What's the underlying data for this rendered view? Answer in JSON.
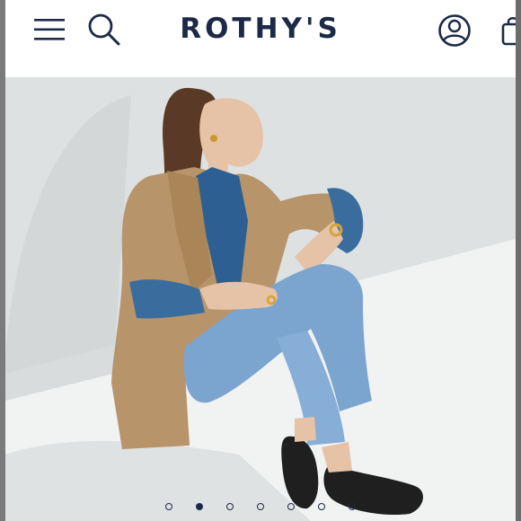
{
  "header": {
    "brand": "ROTHY'S",
    "menu_icon": "hamburger-menu-icon",
    "search_icon": "search-icon",
    "account_icon": "account-icon",
    "bag_icon": "shopping-bag-icon",
    "brand_color": "#1c2a48"
  },
  "hero": {
    "image": "model-seated-in-camel-blazer-denim-black-flats",
    "carousel": {
      "total_slides": 7,
      "active_index": 1
    }
  }
}
